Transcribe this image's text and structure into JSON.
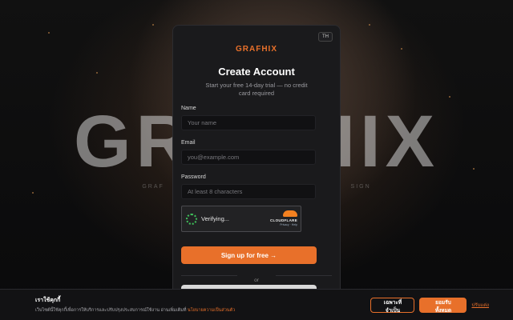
{
  "background": {
    "big_title": "GRAFHIX",
    "subtitle": "GRAF                                                           SIGN"
  },
  "card": {
    "lang_toggle": "TH",
    "brand": "GRAFHIX",
    "heading": "Create Account",
    "tagline": "Start your free 14-day trial — no credit card required",
    "fields": {
      "name": {
        "label": "Name",
        "placeholder": "Your name",
        "value": ""
      },
      "email": {
        "label": "Email",
        "placeholder": "you@example.com",
        "value": ""
      },
      "password": {
        "label": "Password",
        "placeholder": "At least 8 characters",
        "value": ""
      }
    },
    "captcha": {
      "status": "Verifying...",
      "provider": "CLOUDFLARE",
      "links": "Privacy · Help"
    },
    "submit_label": "Sign up for free →",
    "divider_text": "or"
  },
  "cookie_banner": {
    "title": "เราใช้คุกกี้",
    "body": "เว็บไซต์นี้ใช้คุกกี้เพื่อการให้บริการและปรับปรุงประสบการณ์ใช้งาน อ่านเพิ่มเติมที่ ",
    "policy_link": "นโยบายความเป็นส่วนตัว",
    "essential_label": "เฉพาะที่จำเป็น",
    "accept_label": "ยอมรับทั้งหมด",
    "customize_label": "ปรับแต่ง"
  },
  "colors": {
    "accent": "#e8702a",
    "card_bg": "#1a1a1c",
    "captcha_spinner": "#3fbf5a"
  }
}
